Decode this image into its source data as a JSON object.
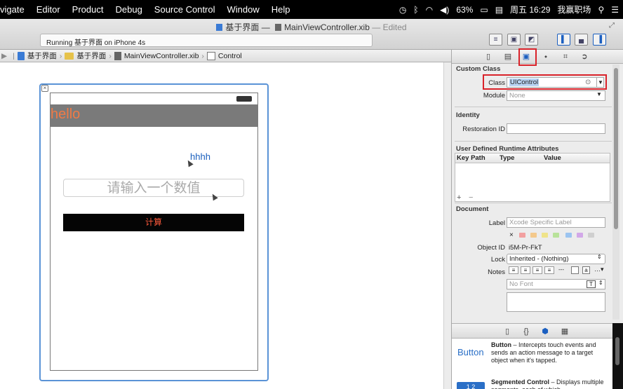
{
  "menubar": {
    "items": [
      "vigate",
      "Editor",
      "Product",
      "Debug",
      "Source Control",
      "Window",
      "Help"
    ],
    "status": {
      "battery": "63%",
      "datetime": "周五 16:29",
      "app": "我赢职场"
    }
  },
  "toolbar": {
    "doc_title": "基于界面 — ",
    "doc_file": "MainViewController.xib",
    "doc_edited": " — Edited",
    "activity": "Running 基于界面 on iPhone 4s"
  },
  "jumpbar": {
    "crumbs": [
      "基于界面",
      "基于界面",
      "MainViewController.xib",
      "Control"
    ]
  },
  "canvas": {
    "nav_title": "hello",
    "label_text": "hhhh",
    "input_placeholder": "请输入一个数值",
    "button_label": "计算"
  },
  "inspector": {
    "custom_class": {
      "title": "Custom Class",
      "class_label": "Class",
      "class_value": "UIControl",
      "module_label": "Module",
      "module_value": "None"
    },
    "identity": {
      "title": "Identity",
      "restoration_label": "Restoration ID",
      "restoration_value": ""
    },
    "runtime": {
      "title": "User Defined Runtime Attributes",
      "columns": [
        "Key Path",
        "Type",
        "Value"
      ],
      "add": "+",
      "remove": "−"
    },
    "document": {
      "title": "Document",
      "label_label": "Label",
      "label_placeholder": "Xcode Specific Label",
      "clear": "×",
      "object_id_label": "Object ID",
      "object_id": "i5M-Pr-FkT",
      "lock_label": "Lock",
      "lock_value": "Inherited - (Nothing)",
      "notes_label": "Notes",
      "font_placeholder": "No Font"
    },
    "swatch_colors": [
      "#f2a0a0",
      "#f4c98c",
      "#efe38a",
      "#b8e29a",
      "#9cc4f0",
      "#d2a8e8",
      "#cfcfcf"
    ]
  },
  "library": {
    "items": [
      {
        "icon_text": "Button",
        "name": "Button",
        "description": " – Intercepts touch events and sends an action message to a target object when it's tapped."
      },
      {
        "icon_text": "1 2",
        "name": "Segmented Control",
        "description": " – Displays multiple segments, each of which"
      }
    ]
  }
}
